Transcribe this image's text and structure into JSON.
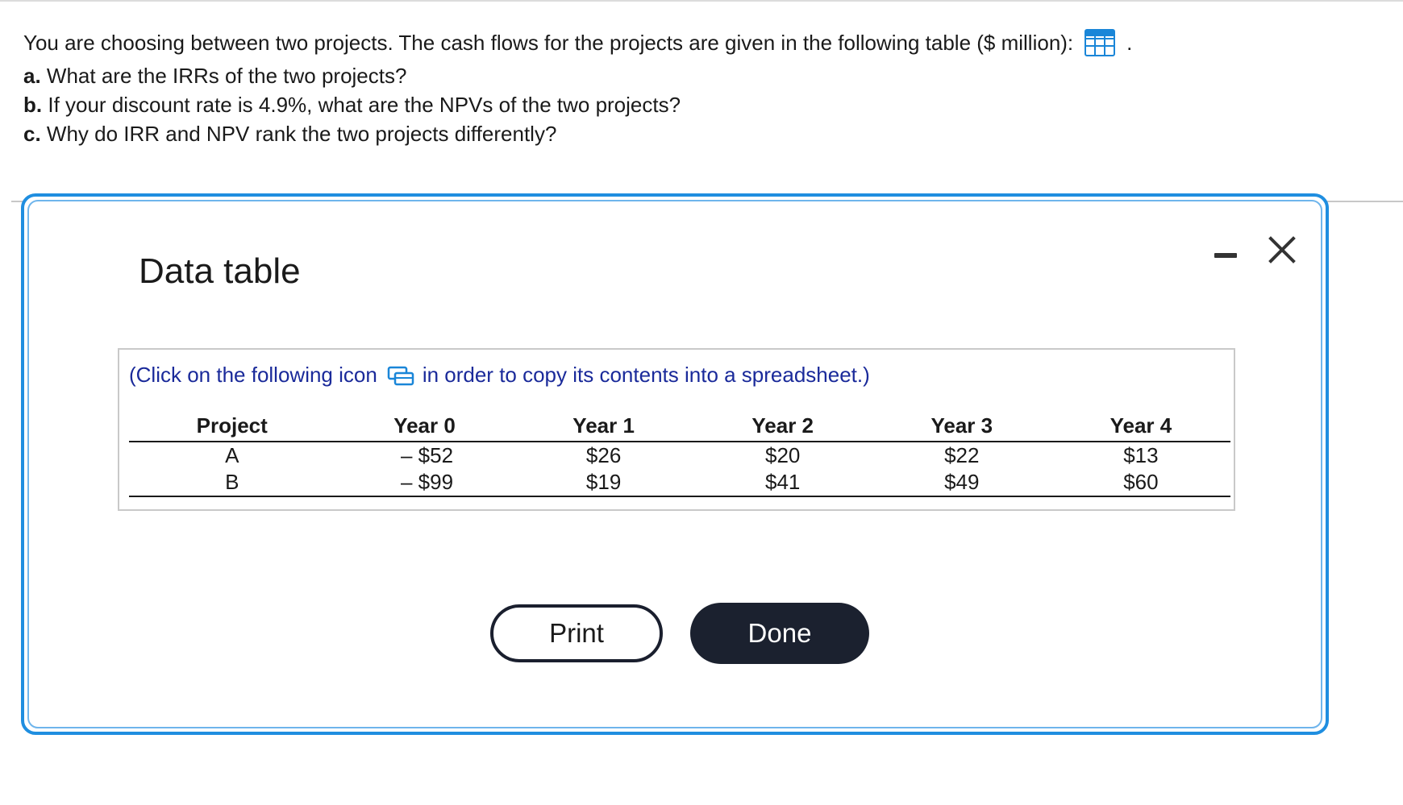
{
  "question": {
    "intro": "You are choosing between two projects. The cash flows for the projects are given in the following table ($ million):",
    "intro_trailing": ".",
    "table_icon": "spreadsheet-grid-icon",
    "items": [
      {
        "label": "a.",
        "text": "What are the IRRs of the two projects?"
      },
      {
        "label": "b.",
        "text": "If your discount rate is 4.9%, what are the NPVs of the two projects?"
      },
      {
        "label": "c.",
        "text": "Why do IRR and NPV rank the two projects differently?"
      }
    ]
  },
  "dialog": {
    "title": "Data table",
    "minimize_icon": "minimize-icon",
    "close_icon": "close-icon",
    "instruction_before": "(Click on the following icon",
    "instruction_after": "in order to copy its contents into a spreadsheet.)",
    "copy_icon": "copy-to-spreadsheet-icon",
    "table": {
      "headers": [
        "Project",
        "Year 0",
        "Year 1",
        "Year 2",
        "Year 3",
        "Year 4"
      ],
      "rows": [
        [
          "A",
          "– $52",
          "$26",
          "$20",
          "$22",
          "$13"
        ],
        [
          "B",
          "– $99",
          "$19",
          "$41",
          "$49",
          "$60"
        ]
      ]
    },
    "buttons": {
      "print": "Print",
      "done": "Done"
    }
  },
  "colors": {
    "accent": "#1f8ee0",
    "instruction_text": "#1a2a9a",
    "done_button": "#1b212f"
  }
}
